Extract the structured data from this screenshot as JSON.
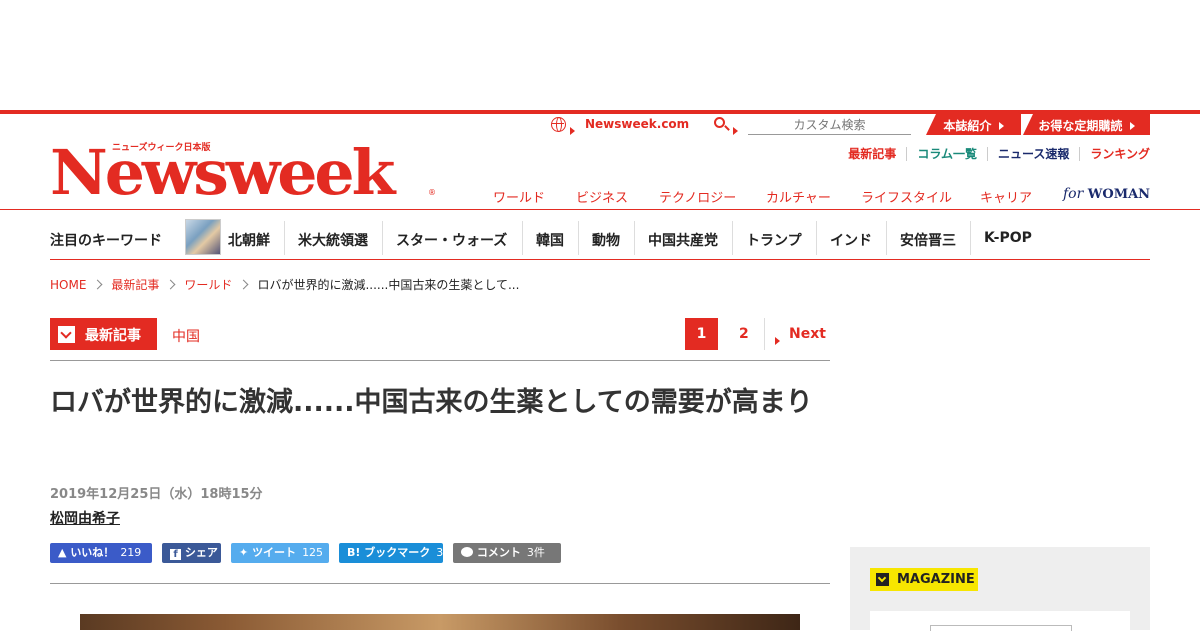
{
  "brand": {
    "logo": "Newsweek",
    "logo_sub": "ニューズウィーク日本版",
    "reg": "®"
  },
  "utility": {
    "site_link": "Newsweek.com",
    "search_placeholder": "カスタム検索",
    "about": "本誌紹介",
    "subscribe": "お得な定期購読"
  },
  "sublinks": [
    "最新記事",
    "コラム一覧",
    "ニュース速報",
    "ランキング"
  ],
  "sublink_colors": [
    "#e32b22",
    "#1a8a7a",
    "#1a2a6c",
    "#e32b22"
  ],
  "main_nav": [
    "ワールド",
    "ビジネス",
    "テクノロジー",
    "カルチャー",
    "ライフスタイル",
    "キャリア"
  ],
  "for_woman": {
    "for": "for",
    "woman": "WOMAN"
  },
  "keywords": {
    "label": "注目のキーワード",
    "items": [
      "北朝鮮",
      "米大統領選",
      "スター・ウォーズ",
      "韓国",
      "動物",
      "中国共産党",
      "トランプ",
      "インド",
      "安倍晋三",
      "K-POP"
    ]
  },
  "breadcrumb": [
    "HOME",
    "最新記事",
    "ワールド",
    "ロバが世界的に激減......中国古来の生薬として..."
  ],
  "section": {
    "tag": "最新記事",
    "category": "中国"
  },
  "pagination": {
    "current": "1",
    "next_page": "2",
    "next": "Next"
  },
  "article": {
    "title": "ロバが世界的に激減......中国古来の生薬としての需要が高まり",
    "date": "2019年12月25日（水）18時15分",
    "author": "松岡由希子"
  },
  "share": [
    {
      "label": "いいね！",
      "count": "219",
      "color": "#3b5bc8"
    },
    {
      "label": "シェア",
      "count": "",
      "color": "#3b5998"
    },
    {
      "label": "ツイート",
      "count": "125",
      "color": "#55acee"
    },
    {
      "label": "ブックマーク",
      "count": "3",
      "color": "#1a8ed8"
    },
    {
      "label": "コメント",
      "count": "3件",
      "color": "#777777"
    }
  ],
  "sidebar": {
    "magazine": "MAGAZINE"
  }
}
